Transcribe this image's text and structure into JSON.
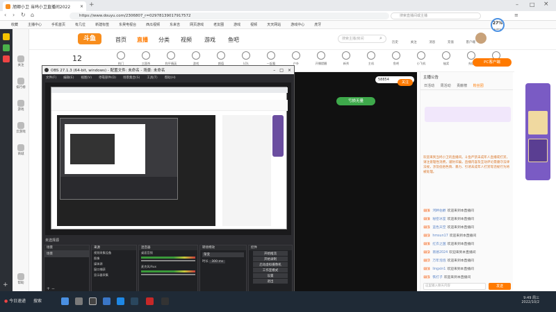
{
  "browser": {
    "tabs": [
      {
        "label": "旭卿小卫 当鸠小卫直播间2022",
        "active": true
      }
    ],
    "url": "https://www.douyu.com/2306807_r=02978139017917572",
    "search_hint": "搜索直播间或主播",
    "weather": {
      "pct": "27%",
      "sub": "9.48°C"
    }
  },
  "bookmarks": [
    "收藏",
    "主播中心",
    "手机首页",
    "有几位",
    "新建标签",
    "东吴电视台",
    "西瓜视频",
    "东来吉",
    "网页游戏",
    "老友圈",
    "游戏",
    "视频",
    "天天网站",
    "游戏中心",
    "虎牙"
  ],
  "sidebar": [
    "关注",
    "排行榜",
    "游戏",
    "云游戏",
    "商城",
    "帮助"
  ],
  "site": {
    "logo": "斗鱼",
    "nav": [
      "首页",
      "直播",
      "分类",
      "视频",
      "游戏",
      "鱼吧"
    ],
    "search_placeholder": "搜索主播/房间",
    "header_icons": [
      "历史",
      "关注",
      "消息",
      "充值",
      "客户端"
    ]
  },
  "categories": [
    "12",
    "热门",
    "三国杀",
    "和平精英",
    "游戏",
    "颜值",
    "LOL",
    "一起看",
    "户外",
    "开播提醒",
    "新秀",
    "主机",
    "鱼吧",
    "小飞机",
    "抽奖",
    "充值",
    "更多"
  ],
  "pc_button": "PC客户端",
  "room": {
    "fans": "58854",
    "follow": "关注",
    "badge": "亏损无量"
  },
  "obs": {
    "title": "OBS 27.1.3 (64-bit, windows) - 配置文件: 未命名 - 场景: 未命名",
    "menu": [
      "文件(F)",
      "编辑(E)",
      "视图(V)",
      "停靠部件(D)",
      "场景集合(S)",
      "工具(T)",
      "帮助(H)"
    ],
    "status": "未选择源",
    "scenes_title": "场景",
    "sources_title": "来源",
    "mixer_title": "混音器",
    "transition_title": "转场特效",
    "controls_title": "控件",
    "scene_items": [
      "场景"
    ],
    "source_items": [
      "视频采集设备",
      "图像",
      "媒体源",
      "窗口捕获",
      "显示器采集"
    ],
    "mixer_items": [
      "桌面音频",
      "麦克风/Aux"
    ],
    "transition_value": "渐变",
    "duration_label": "时长",
    "duration_value": "300 ms",
    "controls": [
      "开始推流",
      "开始录制",
      "启动虚拟摄像机",
      "工作室模式",
      "设置",
      "退出"
    ],
    "statusbar": "LIVE: 00:00:00   REC: 00:00:00   CPU: 1.9%, 60.00 fps"
  },
  "right_panel": {
    "tabs": [
      "日活动",
      "周活动",
      "贡献榜",
      "粉丝团"
    ],
    "host": "主播公告",
    "messages": [
      {
        "level": "LV 6",
        "name": "河畔伯爵",
        "text": "欢迎来到本直播间"
      },
      {
        "level": "LV 8",
        "name": "秘密冰室",
        "text": "欢迎来到本直播间"
      },
      {
        "level": "LV 5",
        "name": "蓝色天空",
        "text": "欢迎来到本直播间"
      },
      {
        "level": "LV 3",
        "name": "hmsun17",
        "text": "欢迎来到本直播间"
      },
      {
        "level": "LV 6",
        "name": "红衣之国",
        "text": "欢迎来到本直播间"
      },
      {
        "level": "LV 2",
        "name": "南德2024",
        "text": "欢迎来到本直播间"
      },
      {
        "level": "LV 7",
        "name": "万年泡泡",
        "text": "欢迎来到本直播间"
      },
      {
        "level": "LV 4",
        "name": "lingxin1",
        "text": "欢迎来到本直播间"
      },
      {
        "level": "LV 5",
        "name": "铁打子",
        "text": "欢迎来到本直播间"
      }
    ],
    "notice": "欢迎来到当鸠小卫的直播间。斗鱼严禁未成年人直播或打赏，请注意理性消费，谨防诈骗，直播内容及互动评论需遵守法律法规，涉及低俗色情、暴力、引诱未成年人打赏等违规行为将被处理。",
    "input_placeholder": "这里输入聊天内容",
    "send": "发送",
    "gift": "等级礼包"
  },
  "taskbar": {
    "start": "今日速递",
    "items": [
      "搜索",
      "微信"
    ],
    "time": "9:49 周三",
    "date": "2022/10/2"
  },
  "colors": {
    "accent": "#ff7a00",
    "douyu_orange": "#f88d1c",
    "obs_bg": "#2a2a2e",
    "taskbar": "#1f2a36"
  }
}
